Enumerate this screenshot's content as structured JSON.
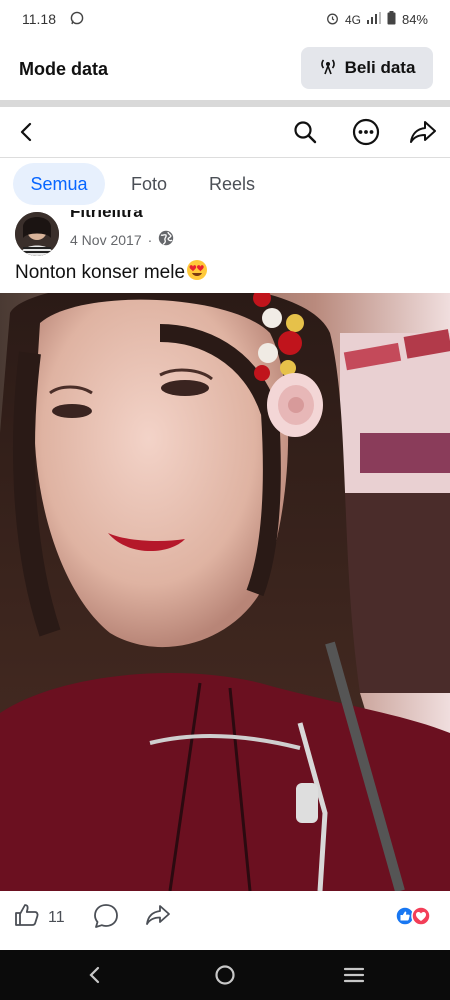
{
  "status": {
    "time": "11.18",
    "network": "4G",
    "battery": "84%"
  },
  "data_bar": {
    "title": "Mode data",
    "buy_label": "Beli data"
  },
  "tabs": [
    {
      "label": "Semua",
      "active": true
    },
    {
      "label": "Foto",
      "active": false
    },
    {
      "label": "Reels",
      "active": false
    }
  ],
  "post": {
    "author": "Fitrielitra",
    "date": "4 Nov 2017",
    "separator": "·",
    "caption": "Nonton konser mele",
    "likes": "11"
  },
  "colors": {
    "accent": "#0866ff",
    "like_blue": "#1877f2",
    "love_red": "#f33e58"
  }
}
